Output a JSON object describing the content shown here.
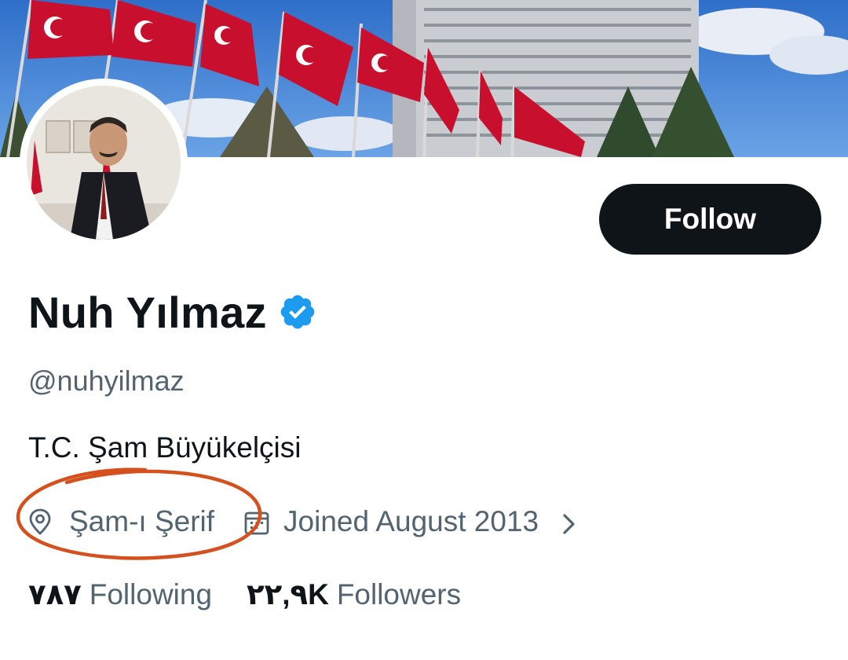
{
  "profile": {
    "name": "Nuh Yılmaz",
    "handle": "@nuhyilmaz",
    "bio": "T.C. Şam Büyükelçisi",
    "location": "Şam-ı Şerif",
    "joined": "Joined August 2013",
    "verified": true
  },
  "actions": {
    "follow_label": "Follow"
  },
  "stats": {
    "following_count": "٧٨٧",
    "following_label": "Following",
    "followers_count": "٢٢,٩K",
    "followers_label": "Followers"
  },
  "icons": {
    "verified": "verified-badge-icon",
    "location": "location-pin-icon",
    "calendar": "calendar-icon",
    "chevron": "chevron-right-icon"
  },
  "colors": {
    "follow_button_bg": "#0f1419",
    "verified_blue": "#1d9bf0",
    "secondary_text": "#536471",
    "highlight_circle": "#d4501e"
  }
}
